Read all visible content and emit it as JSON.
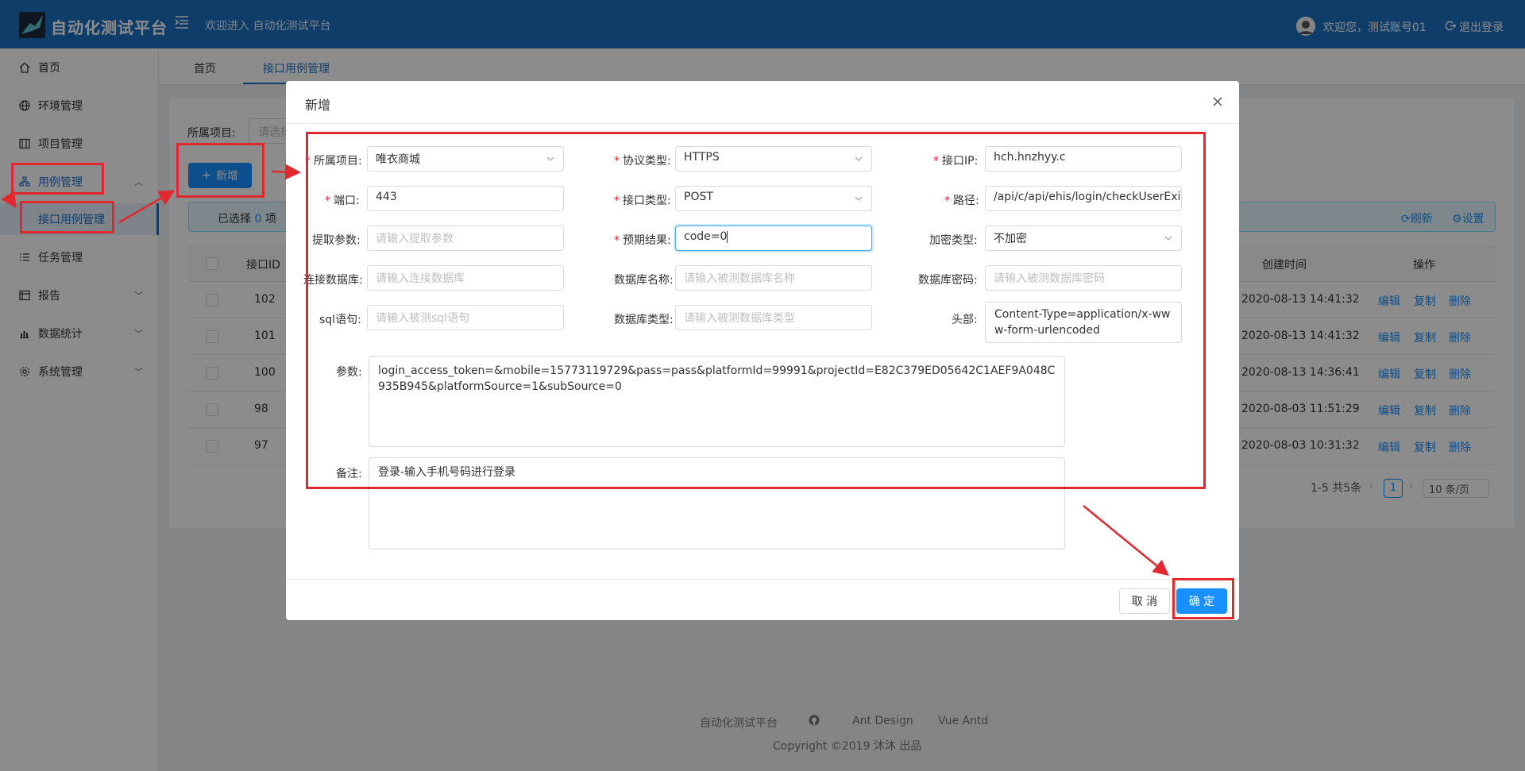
{
  "header": {
    "brand": "自动化测试平台",
    "welcome": "欢迎进入 自动化测试平台",
    "user": "欢迎您，测试账号01",
    "logout": "退出登录"
  },
  "sidebar": {
    "items": [
      {
        "label": "首页",
        "icon": "home-icon"
      },
      {
        "label": "环境管理",
        "icon": "globe-icon"
      },
      {
        "label": "项目管理",
        "icon": "project-icon"
      },
      {
        "label": "用例管理",
        "icon": "case-icon"
      },
      {
        "label": "接口用例管理",
        "icon": ""
      },
      {
        "label": "任务管理",
        "icon": "list-icon"
      },
      {
        "label": "报告",
        "icon": "report-icon"
      },
      {
        "label": "数据统计",
        "icon": "chart-icon"
      },
      {
        "label": "系统管理",
        "icon": "gear-icon"
      }
    ]
  },
  "tabs": [
    {
      "label": "首页"
    },
    {
      "label": "接口用例管理"
    }
  ],
  "filter": {
    "label": "所属项目:",
    "placeholder": "请选择"
  },
  "toolbar": {
    "add_label": "新增"
  },
  "alert": {
    "selected_prefix": "已选择",
    "selected_count": "0",
    "selected_suffix": "项",
    "refresh": "刷新",
    "settings": "设置"
  },
  "table": {
    "headers": {
      "id": "接口ID",
      "created": "创建时间",
      "action": "操作"
    },
    "rows": [
      {
        "id": "102",
        "created": "2020-08-13 14:41:32"
      },
      {
        "id": "101",
        "created": "2020-08-13 14:41:32"
      },
      {
        "id": "100",
        "created": "2020-08-13 14:36:41"
      },
      {
        "id": "98",
        "created": "2020-08-03 11:51:29"
      },
      {
        "id": "97",
        "created": "2020-08-03 10:31:32"
      }
    ],
    "actions": {
      "edit": "编辑",
      "copy": "复制",
      "delete": "删除"
    }
  },
  "pagination": {
    "total": "1-5 共5条",
    "page": "1",
    "page_size": "10 条/页"
  },
  "footer": {
    "links": [
      "自动化测试平台",
      "Ant Design",
      "Vue Antd"
    ],
    "copyright": "Copyright ©2019 沐沐 出品"
  },
  "modal": {
    "title": "新增",
    "fields": {
      "project": {
        "label": "所属项目",
        "value": "唯衣商城"
      },
      "protocol": {
        "label": "协议类型",
        "value": "HTTPS"
      },
      "ip": {
        "label": "接口IP",
        "value": "hch.hnzhyy.c"
      },
      "port": {
        "label": "端口",
        "value": "443"
      },
      "method": {
        "label": "接口类型",
        "value": "POST"
      },
      "path": {
        "label": "路径",
        "value": "/api/c/api/ehis/login/checkUserExists"
      },
      "extract": {
        "label": "提取参数",
        "placeholder": "请输入提取参数"
      },
      "expected": {
        "label": "预期结果",
        "value": "code=0"
      },
      "encrypt": {
        "label": "加密类型",
        "value": "不加密"
      },
      "db_conn": {
        "label": "连接数据库",
        "placeholder": "请输入连接数据库"
      },
      "db_name": {
        "label": "数据库名称",
        "placeholder": "请输入被测数据库名称"
      },
      "db_pwd": {
        "label": "数据库密码",
        "placeholder": "请输入被测数据库密码"
      },
      "sql": {
        "label": "sql语句",
        "placeholder": "请输入被测sql语句"
      },
      "db_type": {
        "label": "数据库类型",
        "placeholder": "请输入被测数据库类型"
      },
      "header": {
        "label": "头部",
        "value": "Content-Type=application/x-www-form-urlencoded"
      },
      "params": {
        "label": "参数",
        "value": "login_access_token=&mobile=15773119729&pass=pass&platformId=99991&projectId=E82C379ED05642C1AEF9A048C935B945&platformSource=1&subSource=0"
      },
      "remark": {
        "label": "备注",
        "value": "登录-输入手机号码进行登录"
      }
    },
    "cancel": "取 消",
    "ok": "确 定"
  },
  "colors": {
    "primary": "#1890ff",
    "header": "#1d6fc2",
    "annotation": "#e0282e",
    "required": "#f5222d"
  }
}
